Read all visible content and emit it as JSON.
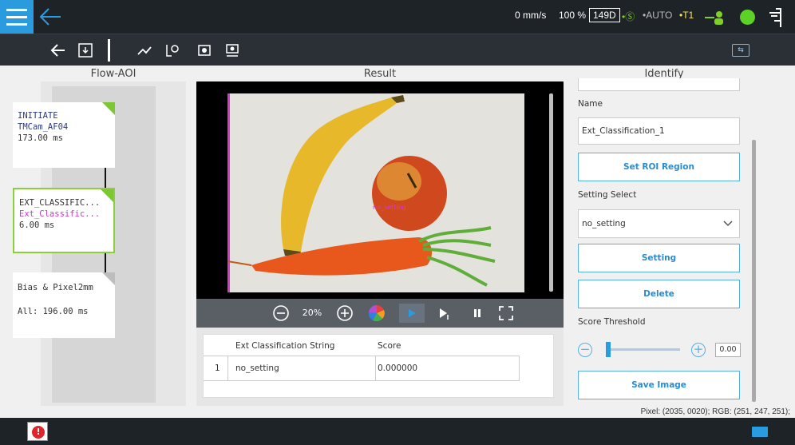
{
  "topbar": {
    "speed": "0 mm/s",
    "speed_pct": "100 %",
    "project_code": "149D",
    "mode_s": "•Ⓢ",
    "mode_auto": "•AUTO",
    "mode_t1": "•T1"
  },
  "columns": {
    "flow_title": "Flow-AOI",
    "result_title": "Result",
    "identify_title": "Identify"
  },
  "flow": {
    "nodes": [
      {
        "line1": "INITIATE",
        "line2": "TMCam_AF04",
        "line3": "173.00 ms"
      },
      {
        "line1": "EXT_CLASSIFIC...",
        "line2": "Ext_Classific...",
        "line3": "6.00 ms"
      },
      {
        "line1": "Bias & Pixel2mm",
        "line2": "",
        "line3": "All: 196.00 ms"
      }
    ]
  },
  "result": {
    "overlay_label": "no_setting",
    "zoom": "20%",
    "table": {
      "headers": [
        "Ext Classification String",
        "Score"
      ],
      "rows": [
        {
          "index": "1",
          "label": "no_setting",
          "score": "0.000000"
        }
      ]
    }
  },
  "identify": {
    "name_label": "Name",
    "name_value": "Ext_Classification_1",
    "set_roi_button": "Set ROI Region",
    "setting_select_label": "Setting Select",
    "setting_select_value": "no_setting",
    "setting_button": "Setting",
    "delete_button": "Delete",
    "score_threshold_label": "Score Threshold",
    "score_threshold_value": "0.00",
    "score_threshold_fraction": 0.0,
    "save_image_button": "Save Image"
  },
  "footer": {
    "pixel_info": "Pixel: (2035, 0020); RGB: (251, 247, 251);",
    "alert_glyph": "!"
  },
  "colors": {
    "accent": "#2b9be0",
    "node_active": "#8ccf3c",
    "status_green": "#5cd126"
  }
}
